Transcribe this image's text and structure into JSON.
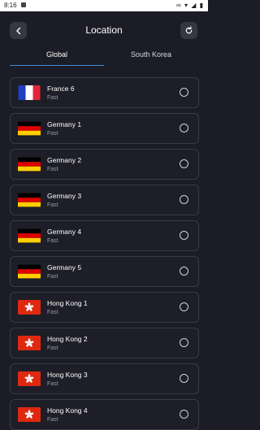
{
  "status_bar": {
    "time": "8:16",
    "icons": "∞ ▾ ◢ ▮"
  },
  "header": {
    "title": "Location",
    "back_icon": "chevron-left-icon",
    "refresh_icon": "refresh-icon"
  },
  "tabs": {
    "global": "Global",
    "south_korea": "South Korea",
    "active": "Global",
    "accent": "#3b8fd6"
  },
  "servers": [
    {
      "name": "France 6",
      "speed": "Fast",
      "flag": "france"
    },
    {
      "name": "Germany 1",
      "speed": "Fast",
      "flag": "germany"
    },
    {
      "name": "Germany 2",
      "speed": "Fast",
      "flag": "germany"
    },
    {
      "name": "Germany 3",
      "speed": "Fast",
      "flag": "germany"
    },
    {
      "name": "Germany 4",
      "speed": "Fast",
      "flag": "germany"
    },
    {
      "name": "Germany 5",
      "speed": "Fast",
      "flag": "germany"
    },
    {
      "name": "Hong Kong 1",
      "speed": "Fast",
      "flag": "hong-kong"
    },
    {
      "name": "Hong Kong 2",
      "speed": "Fast",
      "flag": "hong-kong"
    },
    {
      "name": "Hong Kong 3",
      "speed": "Fast",
      "flag": "hong-kong"
    },
    {
      "name": "Hong Kong 4",
      "speed": "Fast",
      "flag": "hong-kong"
    }
  ]
}
